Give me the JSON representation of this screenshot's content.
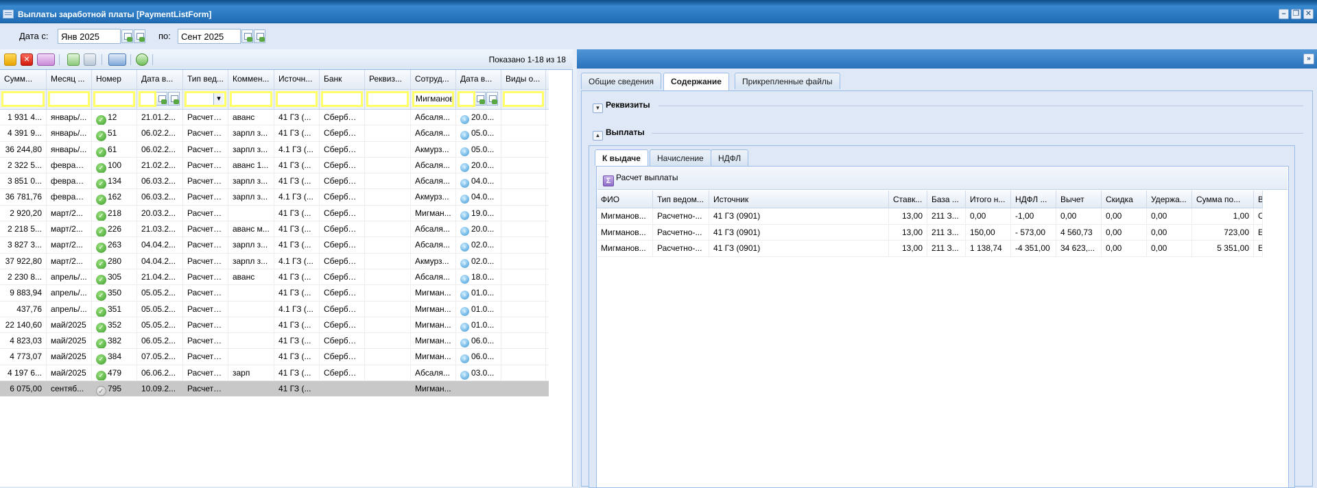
{
  "window": {
    "title": "Выплаты заработной платы [PaymentListForm]",
    "controls": [
      "–",
      "❐",
      "✕"
    ]
  },
  "filter": {
    "date_from_label": "Дата с:",
    "date_from_value": "Янв 2025",
    "date_to_label": "по:",
    "date_to_value": "Сент 2025"
  },
  "toolbar": {
    "shown": "Показано 1-18 из 18",
    "icons": [
      "edit-icon",
      "delete-icon",
      "add-dropdown-icon",
      "approve-icon",
      "unapprove-icon",
      "print-dropdown-icon",
      "refresh-icon"
    ]
  },
  "grid": {
    "columns": [
      "Сумм...",
      "Месяц ...",
      "Номер",
      "Дата в...",
      "Тип вед...",
      "Коммен...",
      "Источн...",
      "Банк",
      "Реквиз...",
      "Сотруд...",
      "Дата в...",
      "Виды о..."
    ],
    "filter_employee": "Мигманов",
    "rows": [
      [
        "1 931 4...",
        "январь/...",
        "12",
        "21.01.2...",
        "Расчетн...",
        "аванс",
        "41 ГЗ (...",
        "Сбербанк",
        "",
        "Абсаля...",
        "20.0...",
        ""
      ],
      [
        "4 391 9...",
        "январь/...",
        "51",
        "06.02.2...",
        "Расчетн...",
        "зарпл з...",
        "41 ГЗ (...",
        "Сбербанк",
        "",
        "Абсаля...",
        "05.0...",
        ""
      ],
      [
        "36 244,80",
        "январь/...",
        "61",
        "06.02.2...",
        "Расчетн...",
        "зарпл з...",
        "4.1 ГЗ (...",
        "Сбербанк",
        "",
        "Акмурз...",
        "05.0...",
        ""
      ],
      [
        "2 322 5...",
        "феврал...",
        "100",
        "21.02.2...",
        "Расчетн...",
        "аванс 1...",
        "41 ГЗ (...",
        "Сбербанк",
        "",
        "Абсаля...",
        "20.0...",
        ""
      ],
      [
        "3 851 0...",
        "феврал...",
        "134",
        "06.03.2...",
        "Расчетн...",
        "зарпл з...",
        "41 ГЗ (...",
        "Сбербанк",
        "",
        "Абсаля...",
        "04.0...",
        ""
      ],
      [
        "36 781,76",
        "феврал...",
        "162",
        "06.03.2...",
        "Расчетн...",
        "зарпл з...",
        "4.1 ГЗ (...",
        "Сбербанк",
        "",
        "Акмурз...",
        "04.0...",
        ""
      ],
      [
        "2 920,20",
        "март/2...",
        "218",
        "20.03.2...",
        "Расчетн...",
        "",
        "41 ГЗ (...",
        "Сбербанк",
        "",
        "Мигман...",
        "19.0...",
        ""
      ],
      [
        "2 218 5...",
        "март/2...",
        "226",
        "21.03.2...",
        "Расчетн...",
        "аванс м...",
        "41 ГЗ (...",
        "Сбербанк",
        "",
        "Абсаля...",
        "20.0...",
        ""
      ],
      [
        "3 827 3...",
        "март/2...",
        "263",
        "04.04.2...",
        "Расчетн...",
        "зарпл з...",
        "41 ГЗ (...",
        "Сбербанк",
        "",
        "Абсаля...",
        "02.0...",
        ""
      ],
      [
        "37 922,80",
        "март/2...",
        "280",
        "04.04.2...",
        "Расчетн...",
        "зарпл з...",
        "4.1 ГЗ (...",
        "Сбербанк",
        "",
        "Акмурз...",
        "02.0...",
        ""
      ],
      [
        "2 230 8...",
        "апрель/...",
        "305",
        "21.04.2...",
        "Расчетн...",
        "аванс",
        "41 ГЗ (...",
        "Сбербанк",
        "",
        "Абсаля...",
        "18.0...",
        ""
      ],
      [
        "9 883,94",
        "апрель/...",
        "350",
        "05.05.2...",
        "Расчетн...",
        "",
        "41 ГЗ (...",
        "Сбербанк",
        "",
        "Мигман...",
        "01.0...",
        ""
      ],
      [
        "437,76",
        "апрель/...",
        "351",
        "05.05.2...",
        "Расчетн...",
        "",
        "4.1 ГЗ (...",
        "Сбербанк",
        "",
        "Мигман...",
        "01.0...",
        ""
      ],
      [
        "22 140,60",
        "май/2025",
        "352",
        "05.05.2...",
        "Расчетн...",
        "",
        "41 ГЗ (...",
        "Сбербанк",
        "",
        "Мигман...",
        "01.0...",
        ""
      ],
      [
        "4 823,03",
        "май/2025",
        "382",
        "06.05.2...",
        "Расчетн...",
        "",
        "41 ГЗ (...",
        "Сбербанк",
        "",
        "Мигман...",
        "06.0...",
        ""
      ],
      [
        "4 773,07",
        "май/2025",
        "384",
        "07.05.2...",
        "Расчетн...",
        "",
        "41 ГЗ (...",
        "Сбербанк",
        "",
        "Мигман...",
        "06.0...",
        ""
      ],
      [
        "4 197 6...",
        "май/2025",
        "479",
        "06.06.2...",
        "Расчетн...",
        "зарп",
        "41 ГЗ (...",
        "Сбербанк",
        "",
        "Абсаля...",
        "03.0...",
        ""
      ],
      [
        "6 075,00",
        "сентяб...",
        "795",
        "10.09.2...",
        "Расчетн...",
        "",
        "41 ГЗ (...",
        "",
        "",
        "Мигман...",
        "",
        ""
      ]
    ]
  },
  "right": {
    "tabs": [
      "Общие сведения",
      "Содержание",
      "Прикрепленные файлы"
    ],
    "section_requisites": "Реквизиты",
    "section_payments": "Выплаты",
    "subtabs": [
      "К выдаче",
      "Начисление",
      "НДФЛ"
    ],
    "calc_button": "Расчет выплаты",
    "columns": [
      "ФИО",
      "Тип ведом...",
      "Источник",
      "Ставк...",
      "База ...",
      "Итого н...",
      "НДФЛ ...",
      "Вычет",
      "Скидка",
      "Удержа...",
      "Сумма по...",
      "В"
    ],
    "rows": [
      [
        "Мигманов...",
        "Расчетно-...",
        "41 ГЗ (0901)",
        "13,00",
        "211 З...",
        "0,00",
        "-1,00",
        "0,00",
        "0,00",
        "0,00",
        "1,00",
        "С"
      ],
      [
        "Мигманов...",
        "Расчетно-...",
        "41 ГЗ (0901)",
        "13,00",
        "211 З...",
        "150,00",
        "- 573,00",
        "4 560,73",
        "0,00",
        "0,00",
        "723,00",
        "Е"
      ],
      [
        "Мигманов...",
        "Расчетно-...",
        "41 ГЗ (0901)",
        "13,00",
        "211 З...",
        "1 138,74",
        "-4 351,00",
        "34 623,...",
        "0,00",
        "0,00",
        "5 351,00",
        "Е"
      ]
    ]
  }
}
